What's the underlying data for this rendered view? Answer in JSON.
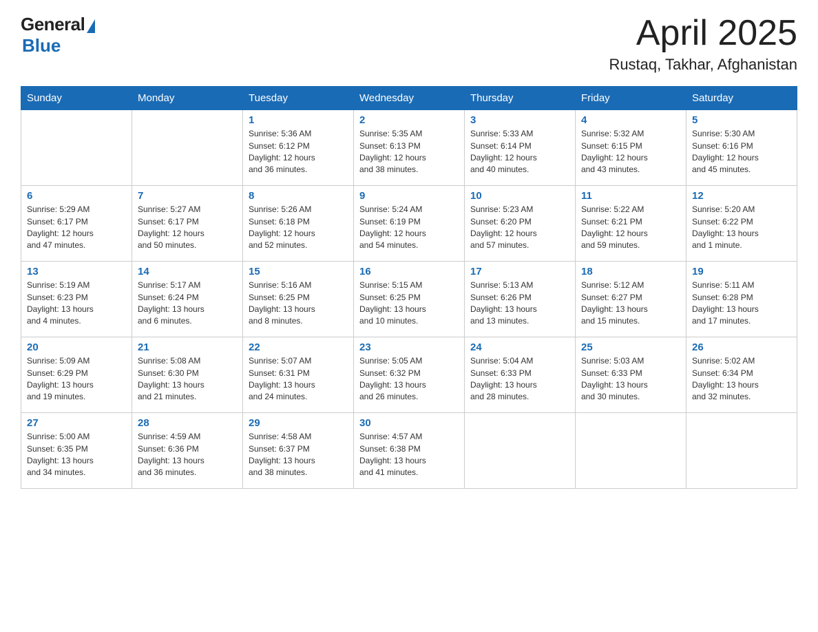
{
  "header": {
    "logo_general": "General",
    "logo_blue": "Blue",
    "title": "April 2025",
    "location": "Rustaq, Takhar, Afghanistan"
  },
  "columns": [
    "Sunday",
    "Monday",
    "Tuesday",
    "Wednesday",
    "Thursday",
    "Friday",
    "Saturday"
  ],
  "weeks": [
    [
      {
        "day": "",
        "info": ""
      },
      {
        "day": "",
        "info": ""
      },
      {
        "day": "1",
        "info": "Sunrise: 5:36 AM\nSunset: 6:12 PM\nDaylight: 12 hours\nand 36 minutes."
      },
      {
        "day": "2",
        "info": "Sunrise: 5:35 AM\nSunset: 6:13 PM\nDaylight: 12 hours\nand 38 minutes."
      },
      {
        "day": "3",
        "info": "Sunrise: 5:33 AM\nSunset: 6:14 PM\nDaylight: 12 hours\nand 40 minutes."
      },
      {
        "day": "4",
        "info": "Sunrise: 5:32 AM\nSunset: 6:15 PM\nDaylight: 12 hours\nand 43 minutes."
      },
      {
        "day": "5",
        "info": "Sunrise: 5:30 AM\nSunset: 6:16 PM\nDaylight: 12 hours\nand 45 minutes."
      }
    ],
    [
      {
        "day": "6",
        "info": "Sunrise: 5:29 AM\nSunset: 6:17 PM\nDaylight: 12 hours\nand 47 minutes."
      },
      {
        "day": "7",
        "info": "Sunrise: 5:27 AM\nSunset: 6:17 PM\nDaylight: 12 hours\nand 50 minutes."
      },
      {
        "day": "8",
        "info": "Sunrise: 5:26 AM\nSunset: 6:18 PM\nDaylight: 12 hours\nand 52 minutes."
      },
      {
        "day": "9",
        "info": "Sunrise: 5:24 AM\nSunset: 6:19 PM\nDaylight: 12 hours\nand 54 minutes."
      },
      {
        "day": "10",
        "info": "Sunrise: 5:23 AM\nSunset: 6:20 PM\nDaylight: 12 hours\nand 57 minutes."
      },
      {
        "day": "11",
        "info": "Sunrise: 5:22 AM\nSunset: 6:21 PM\nDaylight: 12 hours\nand 59 minutes."
      },
      {
        "day": "12",
        "info": "Sunrise: 5:20 AM\nSunset: 6:22 PM\nDaylight: 13 hours\nand 1 minute."
      }
    ],
    [
      {
        "day": "13",
        "info": "Sunrise: 5:19 AM\nSunset: 6:23 PM\nDaylight: 13 hours\nand 4 minutes."
      },
      {
        "day": "14",
        "info": "Sunrise: 5:17 AM\nSunset: 6:24 PM\nDaylight: 13 hours\nand 6 minutes."
      },
      {
        "day": "15",
        "info": "Sunrise: 5:16 AM\nSunset: 6:25 PM\nDaylight: 13 hours\nand 8 minutes."
      },
      {
        "day": "16",
        "info": "Sunrise: 5:15 AM\nSunset: 6:25 PM\nDaylight: 13 hours\nand 10 minutes."
      },
      {
        "day": "17",
        "info": "Sunrise: 5:13 AM\nSunset: 6:26 PM\nDaylight: 13 hours\nand 13 minutes."
      },
      {
        "day": "18",
        "info": "Sunrise: 5:12 AM\nSunset: 6:27 PM\nDaylight: 13 hours\nand 15 minutes."
      },
      {
        "day": "19",
        "info": "Sunrise: 5:11 AM\nSunset: 6:28 PM\nDaylight: 13 hours\nand 17 minutes."
      }
    ],
    [
      {
        "day": "20",
        "info": "Sunrise: 5:09 AM\nSunset: 6:29 PM\nDaylight: 13 hours\nand 19 minutes."
      },
      {
        "day": "21",
        "info": "Sunrise: 5:08 AM\nSunset: 6:30 PM\nDaylight: 13 hours\nand 21 minutes."
      },
      {
        "day": "22",
        "info": "Sunrise: 5:07 AM\nSunset: 6:31 PM\nDaylight: 13 hours\nand 24 minutes."
      },
      {
        "day": "23",
        "info": "Sunrise: 5:05 AM\nSunset: 6:32 PM\nDaylight: 13 hours\nand 26 minutes."
      },
      {
        "day": "24",
        "info": "Sunrise: 5:04 AM\nSunset: 6:33 PM\nDaylight: 13 hours\nand 28 minutes."
      },
      {
        "day": "25",
        "info": "Sunrise: 5:03 AM\nSunset: 6:33 PM\nDaylight: 13 hours\nand 30 minutes."
      },
      {
        "day": "26",
        "info": "Sunrise: 5:02 AM\nSunset: 6:34 PM\nDaylight: 13 hours\nand 32 minutes."
      }
    ],
    [
      {
        "day": "27",
        "info": "Sunrise: 5:00 AM\nSunset: 6:35 PM\nDaylight: 13 hours\nand 34 minutes."
      },
      {
        "day": "28",
        "info": "Sunrise: 4:59 AM\nSunset: 6:36 PM\nDaylight: 13 hours\nand 36 minutes."
      },
      {
        "day": "29",
        "info": "Sunrise: 4:58 AM\nSunset: 6:37 PM\nDaylight: 13 hours\nand 38 minutes."
      },
      {
        "day": "30",
        "info": "Sunrise: 4:57 AM\nSunset: 6:38 PM\nDaylight: 13 hours\nand 41 minutes."
      },
      {
        "day": "",
        "info": ""
      },
      {
        "day": "",
        "info": ""
      },
      {
        "day": "",
        "info": ""
      }
    ]
  ]
}
